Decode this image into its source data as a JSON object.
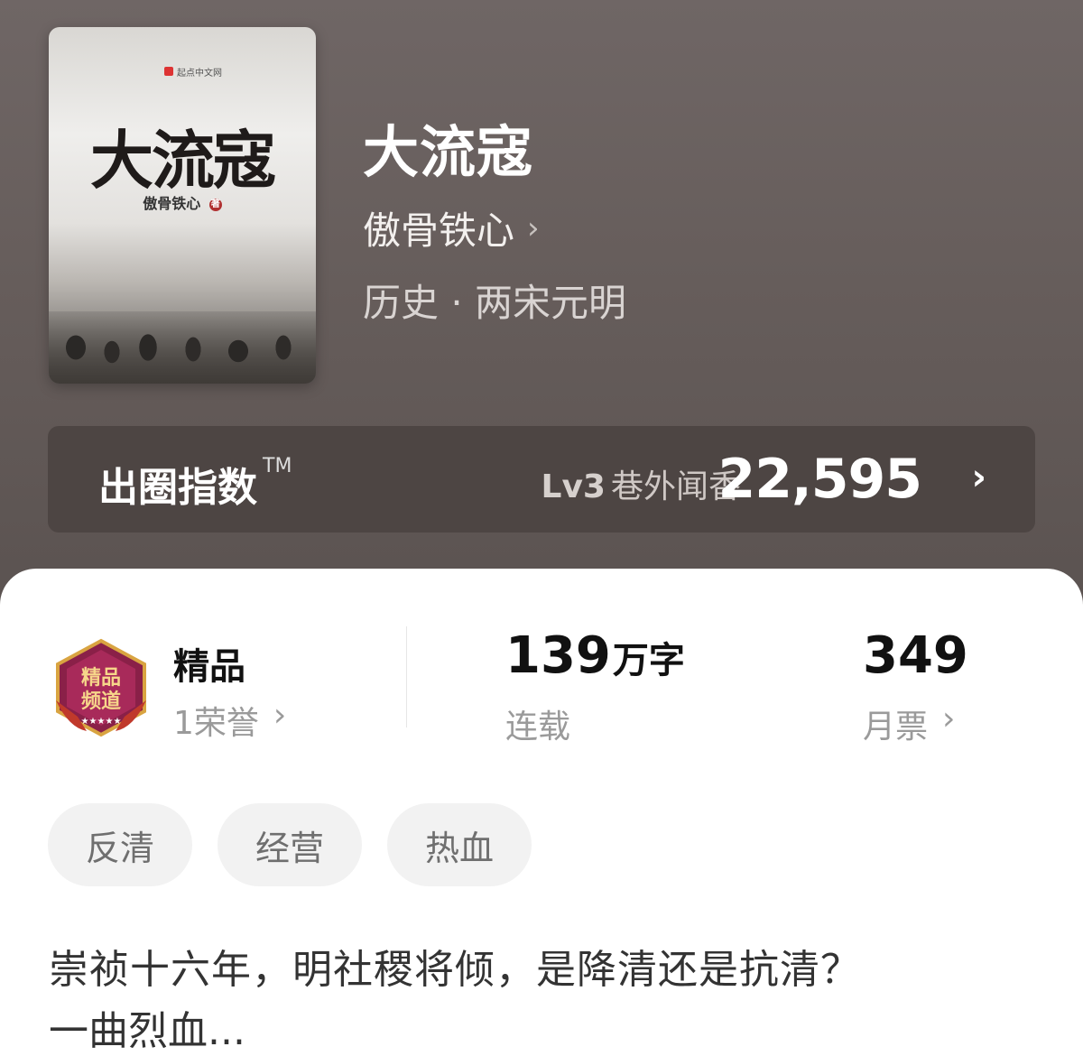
{
  "cover": {
    "publisher": "起点中文网",
    "title": "大流寇",
    "author": "傲骨铁心",
    "seal": "著"
  },
  "book": {
    "title": "大流寇",
    "author": "傲骨铁心",
    "genre": "历史 · 两宋元明"
  },
  "index": {
    "label": "出圈指数",
    "tm": "TM",
    "level": "Lv3",
    "level_name": "巷外闻香",
    "score": "22,595"
  },
  "stats": {
    "quality_title": "精品",
    "quality_sub": "1荣誉",
    "words_num": "139",
    "words_unit": "万字",
    "words_sub": "连载",
    "votes_num": "349",
    "votes_sub": "月票"
  },
  "badge": {
    "text": "精品频道",
    "stars": "★★★★★",
    "color": "#8a2048"
  },
  "tags": [
    "反清",
    "经营",
    "热血"
  ],
  "synopsis": {
    "line1": "崇祯十六年，明社稷将倾，是降清还是抗清？",
    "line2": "一曲烈血..."
  }
}
